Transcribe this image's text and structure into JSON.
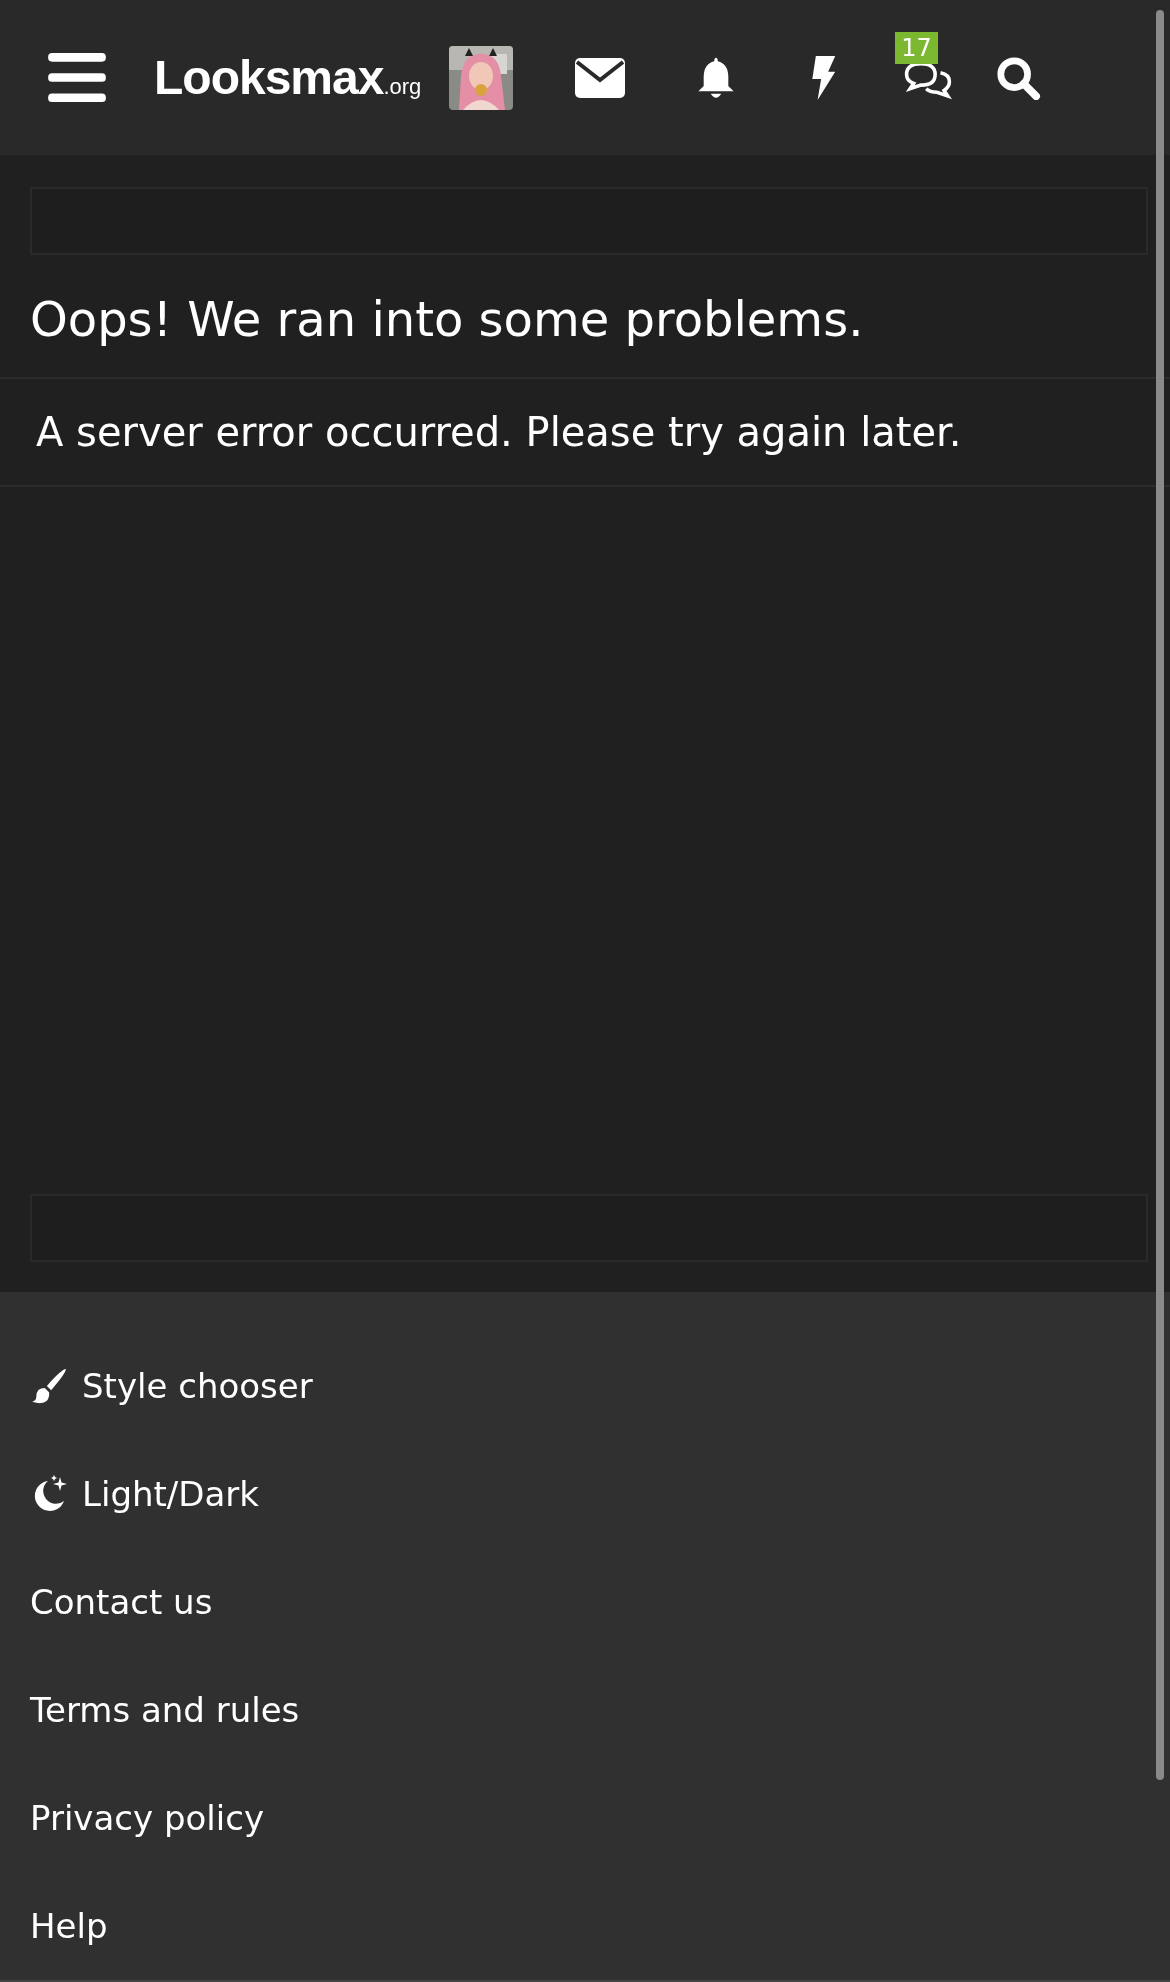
{
  "header": {
    "logo": {
      "name": "Looksmax",
      "suffix": ".org"
    },
    "conversations_badge": "17"
  },
  "error": {
    "title": "Oops! We ran into some problems.",
    "message": "A server error occurred. Please try again later."
  },
  "footer": {
    "items": [
      {
        "label": "Style chooser",
        "kind": "brush"
      },
      {
        "label": "Light/Dark",
        "kind": "moon"
      },
      {
        "label": "Contact us",
        "kind": "plain"
      },
      {
        "label": "Terms and rules",
        "kind": "plain"
      },
      {
        "label": "Privacy policy",
        "kind": "plain"
      },
      {
        "label": "Help",
        "kind": "plain"
      }
    ]
  }
}
